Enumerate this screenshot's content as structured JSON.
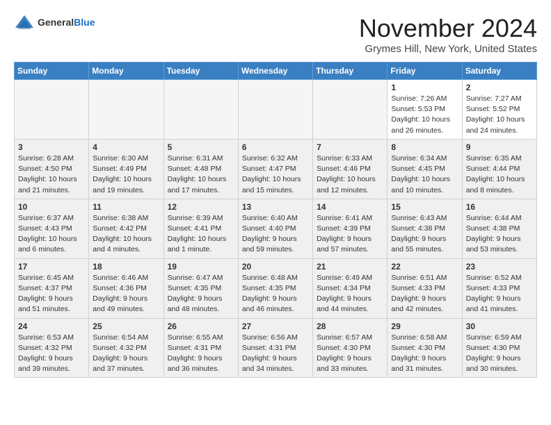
{
  "header": {
    "logo_general": "General",
    "logo_blue": "Blue",
    "month_title": "November 2024",
    "location": "Grymes Hill, New York, United States"
  },
  "weekdays": [
    "Sunday",
    "Monday",
    "Tuesday",
    "Wednesday",
    "Thursday",
    "Friday",
    "Saturday"
  ],
  "weeks": [
    [
      {
        "day": "",
        "info": "",
        "empty": true
      },
      {
        "day": "",
        "info": "",
        "empty": true
      },
      {
        "day": "",
        "info": "",
        "empty": true
      },
      {
        "day": "",
        "info": "",
        "empty": true
      },
      {
        "day": "",
        "info": "",
        "empty": true
      },
      {
        "day": "1",
        "info": "Sunrise: 7:26 AM\nSunset: 5:53 PM\nDaylight: 10 hours\nand 26 minutes.",
        "empty": false
      },
      {
        "day": "2",
        "info": "Sunrise: 7:27 AM\nSunset: 5:52 PM\nDaylight: 10 hours\nand 24 minutes.",
        "empty": false
      }
    ],
    [
      {
        "day": "3",
        "info": "Sunrise: 6:28 AM\nSunset: 4:50 PM\nDaylight: 10 hours\nand 21 minutes.",
        "empty": false
      },
      {
        "day": "4",
        "info": "Sunrise: 6:30 AM\nSunset: 4:49 PM\nDaylight: 10 hours\nand 19 minutes.",
        "empty": false
      },
      {
        "day": "5",
        "info": "Sunrise: 6:31 AM\nSunset: 4:48 PM\nDaylight: 10 hours\nand 17 minutes.",
        "empty": false
      },
      {
        "day": "6",
        "info": "Sunrise: 6:32 AM\nSunset: 4:47 PM\nDaylight: 10 hours\nand 15 minutes.",
        "empty": false
      },
      {
        "day": "7",
        "info": "Sunrise: 6:33 AM\nSunset: 4:46 PM\nDaylight: 10 hours\nand 12 minutes.",
        "empty": false
      },
      {
        "day": "8",
        "info": "Sunrise: 6:34 AM\nSunset: 4:45 PM\nDaylight: 10 hours\nand 10 minutes.",
        "empty": false
      },
      {
        "day": "9",
        "info": "Sunrise: 6:35 AM\nSunset: 4:44 PM\nDaylight: 10 hours\nand 8 minutes.",
        "empty": false
      }
    ],
    [
      {
        "day": "10",
        "info": "Sunrise: 6:37 AM\nSunset: 4:43 PM\nDaylight: 10 hours\nand 6 minutes.",
        "empty": false
      },
      {
        "day": "11",
        "info": "Sunrise: 6:38 AM\nSunset: 4:42 PM\nDaylight: 10 hours\nand 4 minutes.",
        "empty": false
      },
      {
        "day": "12",
        "info": "Sunrise: 6:39 AM\nSunset: 4:41 PM\nDaylight: 10 hours\nand 1 minute.",
        "empty": false
      },
      {
        "day": "13",
        "info": "Sunrise: 6:40 AM\nSunset: 4:40 PM\nDaylight: 9 hours\nand 59 minutes.",
        "empty": false
      },
      {
        "day": "14",
        "info": "Sunrise: 6:41 AM\nSunset: 4:39 PM\nDaylight: 9 hours\nand 57 minutes.",
        "empty": false
      },
      {
        "day": "15",
        "info": "Sunrise: 6:43 AM\nSunset: 4:38 PM\nDaylight: 9 hours\nand 55 minutes.",
        "empty": false
      },
      {
        "day": "16",
        "info": "Sunrise: 6:44 AM\nSunset: 4:38 PM\nDaylight: 9 hours\nand 53 minutes.",
        "empty": false
      }
    ],
    [
      {
        "day": "17",
        "info": "Sunrise: 6:45 AM\nSunset: 4:37 PM\nDaylight: 9 hours\nand 51 minutes.",
        "empty": false
      },
      {
        "day": "18",
        "info": "Sunrise: 6:46 AM\nSunset: 4:36 PM\nDaylight: 9 hours\nand 49 minutes.",
        "empty": false
      },
      {
        "day": "19",
        "info": "Sunrise: 6:47 AM\nSunset: 4:35 PM\nDaylight: 9 hours\nand 48 minutes.",
        "empty": false
      },
      {
        "day": "20",
        "info": "Sunrise: 6:48 AM\nSunset: 4:35 PM\nDaylight: 9 hours\nand 46 minutes.",
        "empty": false
      },
      {
        "day": "21",
        "info": "Sunrise: 6:49 AM\nSunset: 4:34 PM\nDaylight: 9 hours\nand 44 minutes.",
        "empty": false
      },
      {
        "day": "22",
        "info": "Sunrise: 6:51 AM\nSunset: 4:33 PM\nDaylight: 9 hours\nand 42 minutes.",
        "empty": false
      },
      {
        "day": "23",
        "info": "Sunrise: 6:52 AM\nSunset: 4:33 PM\nDaylight: 9 hours\nand 41 minutes.",
        "empty": false
      }
    ],
    [
      {
        "day": "24",
        "info": "Sunrise: 6:53 AM\nSunset: 4:32 PM\nDaylight: 9 hours\nand 39 minutes.",
        "empty": false
      },
      {
        "day": "25",
        "info": "Sunrise: 6:54 AM\nSunset: 4:32 PM\nDaylight: 9 hours\nand 37 minutes.",
        "empty": false
      },
      {
        "day": "26",
        "info": "Sunrise: 6:55 AM\nSunset: 4:31 PM\nDaylight: 9 hours\nand 36 minutes.",
        "empty": false
      },
      {
        "day": "27",
        "info": "Sunrise: 6:56 AM\nSunset: 4:31 PM\nDaylight: 9 hours\nand 34 minutes.",
        "empty": false
      },
      {
        "day": "28",
        "info": "Sunrise: 6:57 AM\nSunset: 4:30 PM\nDaylight: 9 hours\nand 33 minutes.",
        "empty": false
      },
      {
        "day": "29",
        "info": "Sunrise: 6:58 AM\nSunset: 4:30 PM\nDaylight: 9 hours\nand 31 minutes.",
        "empty": false
      },
      {
        "day": "30",
        "info": "Sunrise: 6:59 AM\nSunset: 4:30 PM\nDaylight: 9 hours\nand 30 minutes.",
        "empty": false
      }
    ]
  ]
}
